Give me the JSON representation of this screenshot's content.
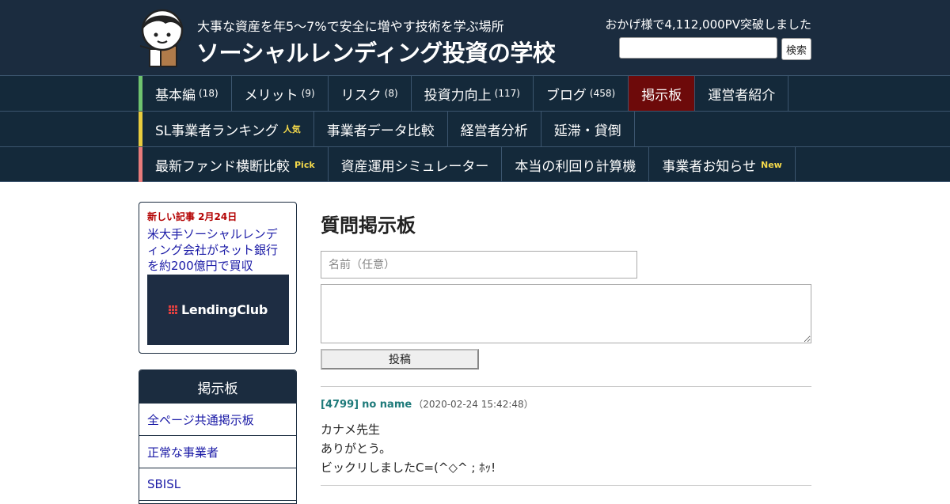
{
  "header": {
    "tagline": "大事な資産を年5～7%で安全に増やす技術を学ぶ場所",
    "title": "ソーシャルレンディング投資の学校",
    "pv_text": "おかげ様で4,112,000PV突破しました",
    "search_button": "検索"
  },
  "nav": {
    "row1": [
      {
        "label": "基本編",
        "count": "(18)"
      },
      {
        "label": "メリット",
        "count": "(9)"
      },
      {
        "label": "リスク",
        "count": "(8)"
      },
      {
        "label": "投資力向上",
        "count": "(117)"
      },
      {
        "label": "ブログ",
        "count": "(458)"
      },
      {
        "label": "掲示板",
        "active": true
      },
      {
        "label": "運営者紹介"
      }
    ],
    "row2": [
      {
        "label": "SL事業者ランキング",
        "tag": "人気"
      },
      {
        "label": "事業者データ比較"
      },
      {
        "label": "経営者分析"
      },
      {
        "label": "延滞・貸倒"
      }
    ],
    "row3": [
      {
        "label": "最新ファンド横断比較",
        "tag": "Pick"
      },
      {
        "label": "資産運用シミュレーター"
      },
      {
        "label": "本当の利回り計算機"
      },
      {
        "label": "事業者お知らせ",
        "tag": "New"
      }
    ]
  },
  "sidebar": {
    "news": {
      "label": "新しい記事 2月24日",
      "link": "米大手ソーシャルレンディング会社がネット銀行を約200億円で買収",
      "thumb_logo": "LendingClub"
    },
    "bbs": {
      "title": "掲示板",
      "items": [
        "全ページ共通掲示板",
        "正常な事業者",
        "SBISL"
      ]
    }
  },
  "main": {
    "title": "質問掲示板",
    "name_placeholder": "名前（任意）",
    "post_button": "投稿",
    "post": {
      "id": "[4799]",
      "name": "no name",
      "date": "（2020-02-24 15:42:48）",
      "lines": [
        "カナメ先生",
        "ありがとう。",
        "ビックリしましたC=(^◇^ ; ﾎｯ!"
      ]
    }
  },
  "colors": {
    "header_bg": "#1b2c3f",
    "nav_bg": "#14293a",
    "nav_active": "#6d0a0a",
    "accent_green": "#6fc36f",
    "accent_yellow": "#e8cc3e",
    "accent_pink": "#e87b7b",
    "link": "#1a1aa6",
    "post_meta": "#1e7a7a"
  }
}
